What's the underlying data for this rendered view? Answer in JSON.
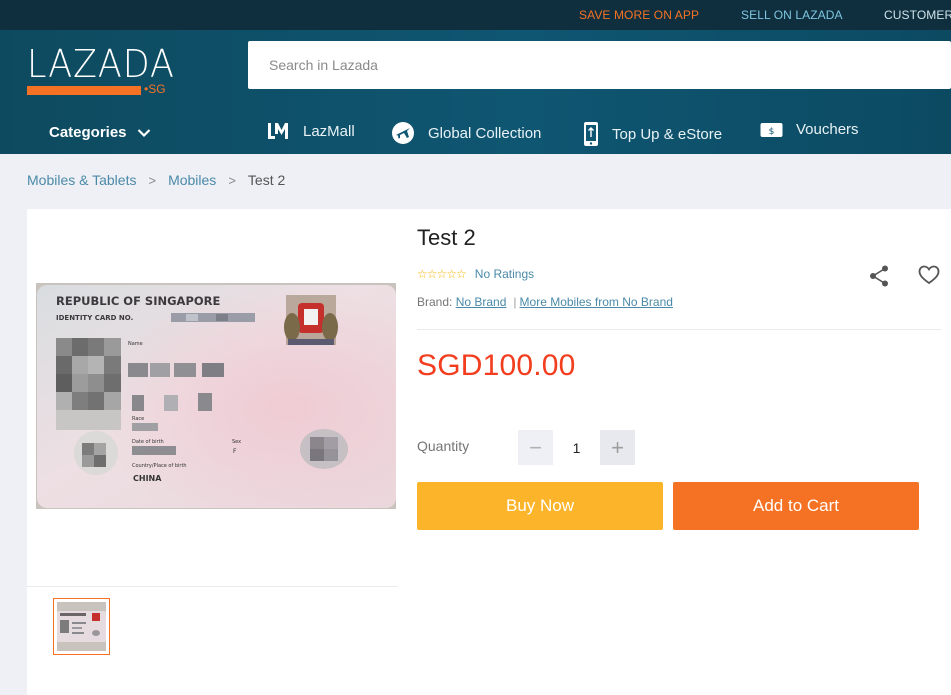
{
  "topbar": {
    "app_promo": "SAVE MORE ON APP",
    "sell": "SELL ON LAZADA",
    "customer": "CUSTOMER"
  },
  "header": {
    "logo_text": "LAZADA",
    "logo_region": "•SG",
    "search_placeholder": "Search in Lazada"
  },
  "nav": {
    "categories": "Categories",
    "items": [
      {
        "label": "LazMall",
        "icon": "lazmall-icon"
      },
      {
        "label": "Global Collection",
        "icon": "plane-icon"
      },
      {
        "label": "Top Up & eStore",
        "icon": "phone-icon"
      },
      {
        "label": "Vouchers",
        "icon": "voucher-icon"
      }
    ]
  },
  "breadcrumb": [
    "Mobiles & Tablets",
    "Mobiles",
    "Test 2"
  ],
  "product": {
    "title": "Test 2",
    "rating_text": "No Ratings",
    "brand_label": "Brand:",
    "brand": "No Brand",
    "more_from": "More Mobiles from No Brand",
    "price": "SGD100.00",
    "quantity_label": "Quantity",
    "quantity": "1",
    "buy_now": "Buy Now",
    "add_to_cart": "Add to Cart"
  },
  "card": {
    "line1": "REPUBLIC OF SINGAPORE",
    "line2": "IDENTITY CARD NO.",
    "field_name": "Name",
    "field_race": "Race",
    "field_dob": "Date of birth",
    "field_sex": "Sex",
    "sex_value": "F",
    "field_country": "Country/Place of birth",
    "country_value": "CHINA"
  },
  "colors": {
    "brand_orange": "#f57224",
    "header_teal": "#0f5672",
    "price_red": "#f23d1e",
    "buy_yellow": "#fcb42a",
    "link_blue": "#4a8aa8"
  }
}
